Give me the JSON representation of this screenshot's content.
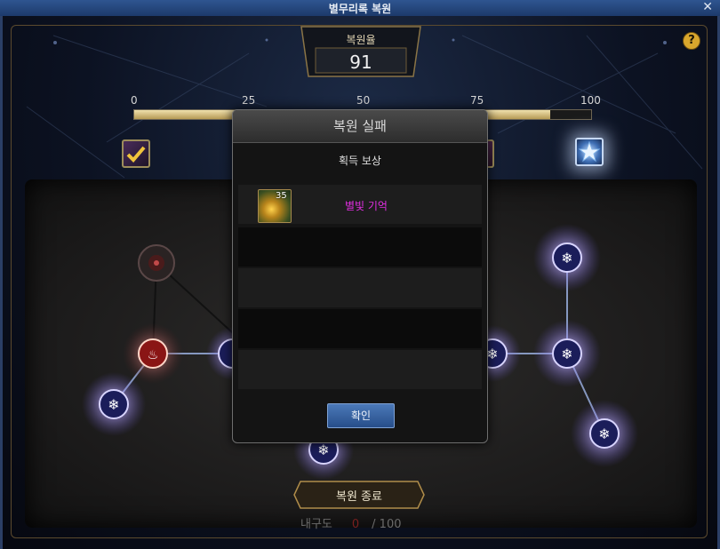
{
  "window": {
    "title": "별무리록 복원",
    "close_label": "✕"
  },
  "rate": {
    "label": "복원율",
    "value": "91"
  },
  "help": {
    "label": "?"
  },
  "progress": {
    "ticks": [
      "0",
      "25",
      "50",
      "75",
      "100"
    ],
    "value": 91
  },
  "dialog": {
    "title": "복원 실패",
    "subtitle": "획득 보상",
    "reward": {
      "name": "별빛 기억",
      "count": "35",
      "icon": "star-memory-icon"
    },
    "confirm_label": "확인"
  },
  "footer": {
    "end_button_label": "복원 종료",
    "durability_label": "내구도",
    "durability_current": "0",
    "durability_max": "/ 100"
  },
  "colors": {
    "accent_gold": "#d9a72d",
    "reward_name": "#e22ee2",
    "button_blue": "#3a64a2"
  }
}
